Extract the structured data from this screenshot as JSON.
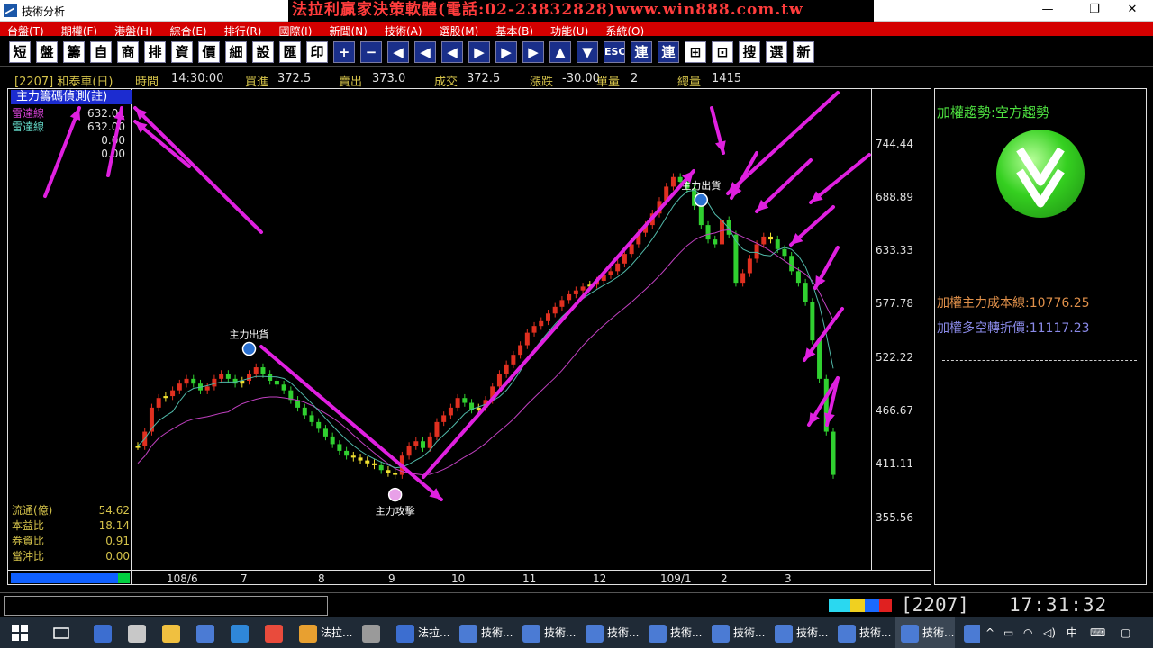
{
  "window": {
    "title": "技術分析",
    "ad_title": "法拉利贏家決策軟體(電話:02-23832828)www.win888.com.tw",
    "controls": {
      "minimize": "—",
      "restore": "❐",
      "close": "✕"
    }
  },
  "menu": [
    "台盤(T)",
    "期權(F)",
    "港盤(H)",
    "綜合(E)",
    "排行(R)",
    "國際(I)",
    "新聞(N)",
    "技術(A)",
    "選股(M)",
    "基本(B)",
    "功能(U)",
    "系統(O)"
  ],
  "toolbar": [
    "短",
    "盤",
    "籌",
    "自",
    "商",
    "排",
    "資",
    "價",
    "細",
    "設",
    "匯",
    "印",
    "+",
    "−",
    "◀",
    "◀",
    "◀",
    "▶",
    "▶",
    "▶",
    "▲",
    "▼",
    "ESC",
    "連",
    "連",
    "⊞",
    "⊡",
    "搜",
    "選",
    "新"
  ],
  "quote": {
    "symbol": "[2207] 和泰車(日)",
    "time_label": "時間",
    "time": "14:30:00",
    "bid_label": "買進",
    "bid": "372.5",
    "ask_label": "賣出",
    "ask": "373.0",
    "deal_label": "成交",
    "deal": "372.5",
    "chg_label": "漲跌",
    "chg": "-30.00",
    "vol_label": "單量",
    "vol": "2",
    "total_label": "總量",
    "total": "1415"
  },
  "indicator": {
    "title": "主力籌碼偵測(註)",
    "legend": [
      {
        "label": "雷達線",
        "value": "632.01",
        "color": "#d040d0"
      },
      {
        "label": "雷達線",
        "value": "632.00",
        "color": "#60d0c0"
      },
      {
        "label": "",
        "value": "0.00",
        "color": "#e0e0e0"
      },
      {
        "label": "",
        "value": "0.00",
        "color": "#e0e0e0"
      }
    ]
  },
  "stats": [
    {
      "label": "流通(億)",
      "value": "54.62"
    },
    {
      "label": "本益比",
      "value": "18.14"
    },
    {
      "label": "券資比",
      "value": "0.91"
    },
    {
      "label": "當沖比",
      "value": "0.00"
    }
  ],
  "y_axis": [
    "744.44",
    "688.89",
    "633.33",
    "577.78",
    "522.22",
    "466.67",
    "411.11",
    "355.56"
  ],
  "x_axis": [
    "108/6",
    "7",
    "8",
    "9",
    "10",
    "11",
    "12",
    "109/1",
    "2",
    "3"
  ],
  "chart_data": {
    "type": "candlestick",
    "ylim": [
      355.56,
      744.44
    ],
    "close_series": [
      430,
      445,
      470,
      480,
      482,
      488,
      495,
      500,
      495,
      488,
      492,
      500,
      505,
      500,
      495,
      498,
      505,
      512,
      505,
      498,
      494,
      488,
      478,
      470,
      462,
      455,
      448,
      440,
      432,
      425,
      420,
      418,
      415,
      412,
      410,
      405,
      402,
      400,
      420,
      430,
      435,
      428,
      440,
      455,
      462,
      470,
      480,
      475,
      468,
      470,
      478,
      492,
      505,
      515,
      525,
      535,
      548,
      555,
      560,
      568,
      575,
      582,
      588,
      592,
      596,
      598,
      602,
      608,
      612,
      620,
      630,
      640,
      652,
      660,
      672,
      685,
      700,
      710,
      705,
      698,
      680,
      660,
      645,
      640,
      665,
      650,
      600,
      610,
      625,
      640,
      648,
      645,
      635,
      628,
      612,
      600,
      580,
      540,
      500,
      445,
      400
    ],
    "annotations": [
      {
        "text": "主力出貨",
        "type": "sell"
      },
      {
        "text": "主力攻擊",
        "type": "buy"
      },
      {
        "text": "主力出貨",
        "type": "sell"
      }
    ]
  },
  "side": {
    "trend_label": "加權趨勢:空方趨勢",
    "cost_label": "加權主力成本線:",
    "cost_value": "10776.25",
    "turn_label": "加權多空轉折價:",
    "turn_value": "11117.23"
  },
  "progress": {
    "fill": 0.1
  },
  "status": {
    "code": "2207",
    "clock": "17:31:32"
  },
  "taskbar": {
    "items": [
      {
        "label": "",
        "color": "#3c6ed0"
      },
      {
        "label": "",
        "color": "#c8c8c8"
      },
      {
        "label": "",
        "color": "#f0c040"
      },
      {
        "label": "",
        "color": "#4b7bd4"
      },
      {
        "label": "",
        "color": "#2f87d8"
      },
      {
        "label": "",
        "color": "#e94b3c"
      },
      {
        "label": "法拉...",
        "color": "#e8a030"
      },
      {
        "label": "",
        "color": "#9a9a9a"
      },
      {
        "label": "法拉...",
        "color": "#3c6ed0"
      },
      {
        "label": "技術...",
        "color": "#4b7bd4"
      },
      {
        "label": "技術...",
        "color": "#4b7bd4"
      },
      {
        "label": "技術...",
        "color": "#4b7bd4"
      },
      {
        "label": "技術...",
        "color": "#4b7bd4"
      },
      {
        "label": "技術...",
        "color": "#4b7bd4"
      },
      {
        "label": "技術...",
        "color": "#4b7bd4"
      },
      {
        "label": "技術...",
        "color": "#4b7bd4"
      },
      {
        "label": "技術...",
        "color": "#4b7bd4"
      },
      {
        "label": "技術...",
        "color": "#4b7bd4"
      },
      {
        "label": "技術...",
        "color": "#4b7bd4"
      }
    ],
    "tray": {
      "chevron": "^",
      "ime": "中"
    }
  }
}
